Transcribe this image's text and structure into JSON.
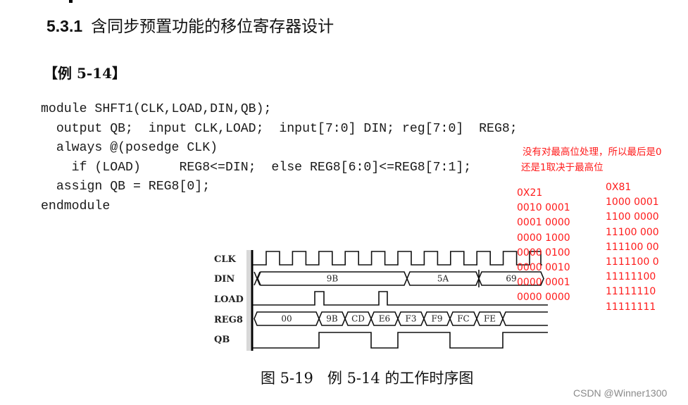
{
  "section": {
    "number": "5.3.1",
    "title": "含同步预置功能的移位寄存器设计"
  },
  "example": {
    "label": "【例 5-14】"
  },
  "code": {
    "lines": [
      "module SHFT1(CLK,LOAD,DIN,QB);",
      "  output QB;  input CLK,LOAD;  input[7:0] DIN; reg[7:0]  REG8;",
      "  always @(posedge CLK)",
      "    if (LOAD)     REG8<=DIN;  else REG8[6:0]<=REG8[7:1];",
      "  assign QB = REG8[0];",
      "endmodule"
    ]
  },
  "annotation": {
    "line1": "没有对最高位处理，所以最后是0",
    "line2": "还是1取决于最高位",
    "color": "#ff1a1a",
    "column_a": [
      "0X21",
      "0010 0001",
      "0001 0000",
      "0000 1000",
      "0000 0100",
      "0000 0010",
      "0000 0001",
      "0000 0000"
    ],
    "column_b": [
      "0X81",
      "1000 0001",
      "1100 0000",
      "11100 000",
      "111100 00",
      "1111100 0",
      "11111100",
      "11111110",
      "11111111"
    ]
  },
  "timing_diagram": {
    "signals": [
      "CLK",
      "DIN",
      "LOAD",
      "REG8",
      "QB"
    ],
    "clock_cycles": 11,
    "din_values": [
      "9B",
      "5A",
      "69"
    ],
    "load_pulse_cycles": [
      2,
      4
    ],
    "reg8_values": [
      "00",
      "9B",
      "CD",
      "E6",
      "F3",
      "F9",
      "FC",
      "FE",
      ""
    ],
    "qb_levels": [
      0,
      0,
      0,
      1,
      1,
      0,
      1,
      1,
      0,
      0,
      1,
      1
    ]
  },
  "caption": {
    "figure": "图 5-19",
    "text": "例 5-14 的工作时序图"
  },
  "watermark": "CSDN @Winner1300"
}
